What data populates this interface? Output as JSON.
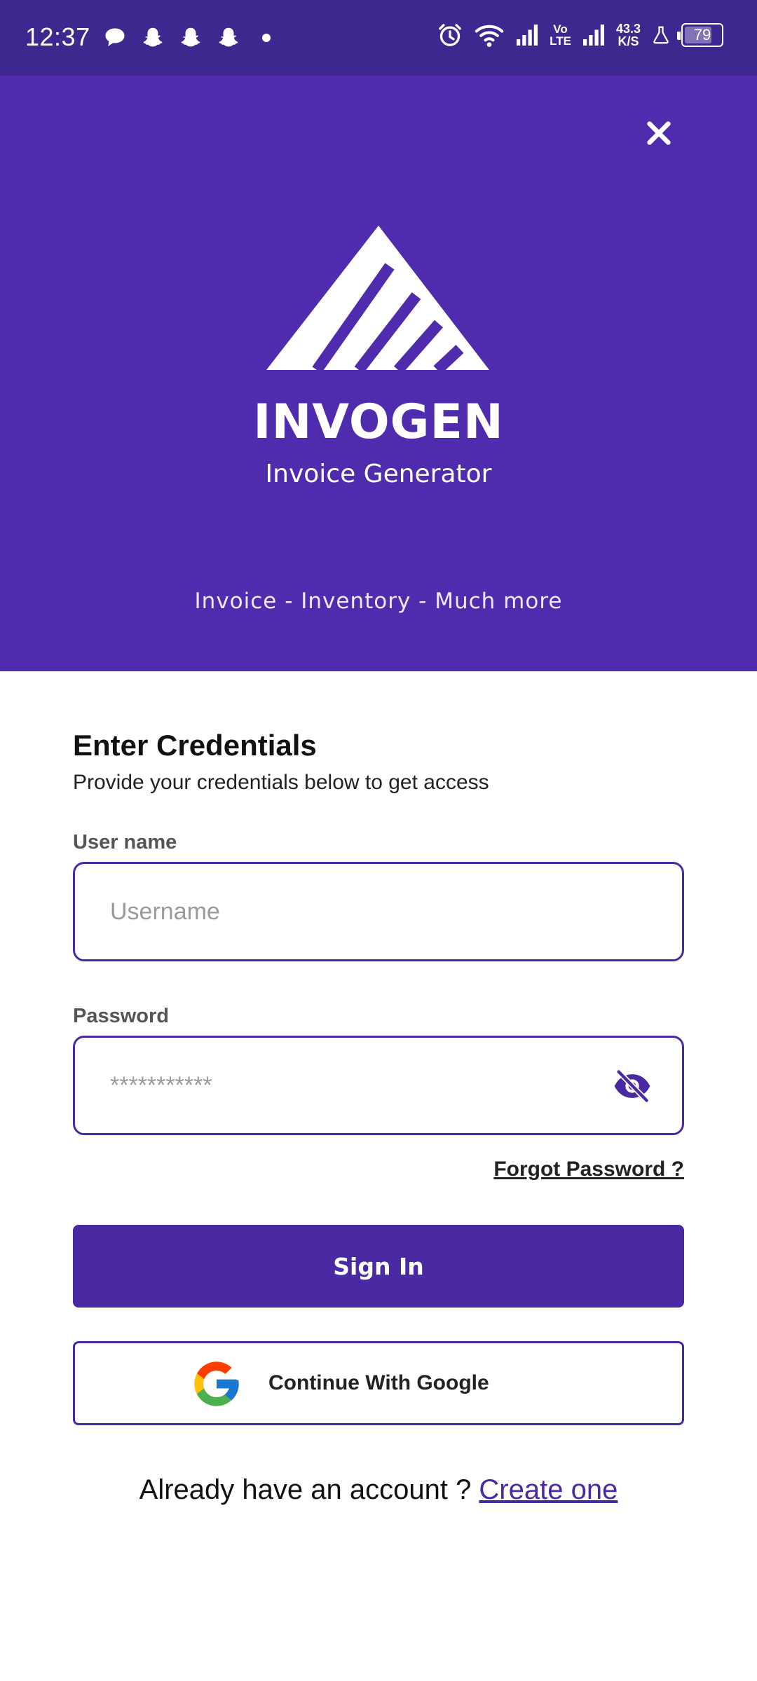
{
  "status_bar": {
    "time": "12:37",
    "network_speed_value": "43.3",
    "network_speed_unit": "K/S",
    "volte": "Vo\nLTE",
    "battery": "79",
    "battery_level": 0.79
  },
  "header": {
    "brand": "INVOGEN",
    "subtitle": "Invoice Generator",
    "tagline": "Invoice - Inventory - Much more",
    "background": "#4f2cae"
  },
  "form": {
    "title": "Enter Credentials",
    "description": "Provide your credentials below to get access",
    "username": {
      "label": "User name",
      "placeholder": "Username",
      "value": ""
    },
    "password": {
      "label": "Password",
      "placeholder": "***********",
      "value": ""
    },
    "forgot_label": "Forgot Password ?",
    "signin_label": "Sign In",
    "google_label": "Continue With Google",
    "account_text": "Already have an account ? ",
    "account_link": "Create one"
  },
  "colors": {
    "accent": "#4a2aa3",
    "status_bar": "#3f2790"
  },
  "icons": {
    "close": "close-icon",
    "password_visibility": "eye-off-icon",
    "google": "google-logo-icon"
  }
}
